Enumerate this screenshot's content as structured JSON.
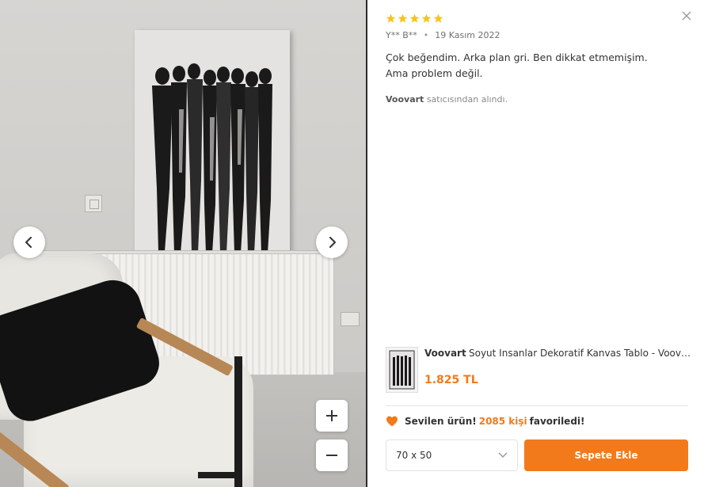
{
  "review": {
    "rating": 5,
    "author": "Y** B**",
    "date": "19 Kasım 2022",
    "text": "Çok beğendim. Arka plan gri. Ben dikkat etmemişim. Ama problem değil.",
    "seller_name": "Voovart",
    "seller_suffix": "satıcısından alındı."
  },
  "product": {
    "brand": "Voovart",
    "name": "Soyut Insanlar Dekoratif Kanvas Tablo - Voov2…",
    "price": "1.825 TL"
  },
  "favorite": {
    "prefix": "Sevilen ürün!",
    "count": "2085 kişi",
    "suffix": "favoriledi!"
  },
  "size_select": {
    "value": "70 x 50"
  },
  "cart_button": {
    "label": "Sepete Ekle"
  },
  "colors": {
    "accent": "#f27a1a",
    "star": "#f8c31d"
  },
  "icons": {
    "close": "close-icon",
    "prev": "chevron-left-icon",
    "next": "chevron-right-icon",
    "zoom_in": "plus-icon",
    "zoom_out": "minus-icon",
    "favorite": "heart-icon",
    "dropdown": "chevron-down-icon"
  }
}
